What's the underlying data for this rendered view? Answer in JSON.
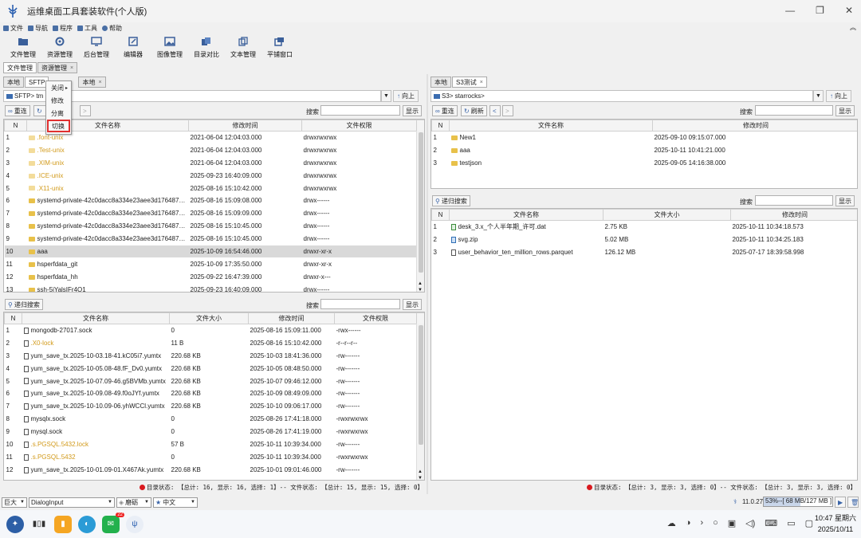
{
  "app": {
    "title": "运维桌面工具套装软件(个人版)"
  },
  "menu": [
    {
      "label": "文件",
      "icon": "file-icon"
    },
    {
      "label": "导航",
      "icon": "navigation-icon"
    },
    {
      "label": "程序",
      "icon": "program-icon"
    },
    {
      "label": "工具",
      "icon": "tools-icon"
    },
    {
      "label": "帮助",
      "icon": "help-icon"
    }
  ],
  "toolbar": [
    {
      "label": "文件管理",
      "icon": "folder-open-icon"
    },
    {
      "label": "资源管理",
      "icon": "resource-icon"
    },
    {
      "label": "后台管理",
      "icon": "monitor-icon"
    },
    {
      "label": "编辑器",
      "icon": "edit-icon"
    },
    {
      "label": "图像管理",
      "icon": "image-icon"
    },
    {
      "label": "目录对比",
      "icon": "compare-icon"
    },
    {
      "label": "文本管理",
      "icon": "text-icon"
    },
    {
      "label": "平铺窗口",
      "icon": "tile-windows-icon"
    }
  ],
  "main_tabs": [
    {
      "label": "文件管理"
    },
    {
      "label": "资源管理"
    }
  ],
  "left": {
    "tabs": [
      {
        "label": "本地"
      },
      {
        "label": "SFTP"
      },
      {
        "label": "本地"
      }
    ],
    "path": "SFTP> tm",
    "up_label": "向上",
    "refresh_label": "重连",
    "search_label": "搜索",
    "show_label": "显示",
    "headers": [
      "N",
      "文件名称",
      "修改时间",
      "文件权限"
    ],
    "rows": [
      {
        "n": "1",
        "name": ".font-unix",
        "time": "2021-06-04 12:04:03.000",
        "perm": "drwxrwxrwx",
        "hidden": true
      },
      {
        "n": "2",
        "name": ".Test-unix",
        "time": "2021-06-04 12:04:03.000",
        "perm": "drwxrwxrwx",
        "hidden": true
      },
      {
        "n": "3",
        "name": ".XIM-unix",
        "time": "2021-06-04 12:04:03.000",
        "perm": "drwxrwxrwx",
        "hidden": true
      },
      {
        "n": "4",
        "name": ".ICE-unix",
        "time": "2025-09-23 16:40:09.000",
        "perm": "drwxrwxrwx",
        "hidden": true
      },
      {
        "n": "5",
        "name": ".X11-unix",
        "time": "2025-08-16 15:10:42.000",
        "perm": "drwxrwxrwx",
        "hidden": true
      },
      {
        "n": "6",
        "name": "systemd-private-42c0dacc8a334e23aee3d1764873...",
        "time": "2025-08-16 15:09:08.000",
        "perm": "drwx------",
        "hidden": false
      },
      {
        "n": "7",
        "name": "systemd-private-42c0dacc8a334e23aee3d1764873...",
        "time": "2025-08-16 15:09:09.000",
        "perm": "drwx------",
        "hidden": false
      },
      {
        "n": "8",
        "name": "systemd-private-42c0dacc8a334e23aee3d1764873...",
        "time": "2025-08-16 15:10:45.000",
        "perm": "drwx------",
        "hidden": false
      },
      {
        "n": "9",
        "name": "systemd-private-42c0dacc8a334e23aee3d1764873...",
        "time": "2025-08-16 15:10:45.000",
        "perm": "drwx------",
        "hidden": false
      },
      {
        "n": "10",
        "name": "aaa",
        "time": "2025-10-09 16:54:46.000",
        "perm": "drwxr-xr-x",
        "hidden": false,
        "selected": true
      },
      {
        "n": "11",
        "name": "hsperfdata_git",
        "time": "2025-10-09 17:35:50.000",
        "perm": "drwxr-xr-x",
        "hidden": false
      },
      {
        "n": "12",
        "name": "hsperfdata_hh",
        "time": "2025-09-22 16:47:39.000",
        "perm": "drwxr-x---",
        "hidden": false
      },
      {
        "n": "13",
        "name": "ssh-5jYalsIFr4Q1",
        "time": "2025-09-23 16:40:09.000",
        "perm": "drwx------",
        "hidden": false
      }
    ],
    "context_menu": [
      "关闭",
      "修改",
      "分离",
      "切换"
    ],
    "recursive_search_label": "递归搜索",
    "file_headers": [
      "N",
      "文件名称",
      "文件大小",
      "修改时间",
      "文件权限"
    ],
    "files": [
      {
        "n": "1",
        "name": "mongodb-27017.sock",
        "size": "0",
        "time": "2025-08-16 15:09:11.000",
        "perm": "-rwx------",
        "hidden": false
      },
      {
        "n": "2",
        "name": ".X0-lock",
        "size": "11 B",
        "time": "2025-08-16 15:10:42.000",
        "perm": "-r--r--r--",
        "hidden": true
      },
      {
        "n": "3",
        "name": "yum_save_tx.2025-10-03.18-41.kC05i7.yumtx",
        "size": "220.68 KB",
        "time": "2025-10-03 18:41:36.000",
        "perm": "-rw-------",
        "hidden": false
      },
      {
        "n": "4",
        "name": "yum_save_tx.2025-10-05.08-48.fF_Dv0.yumtx",
        "size": "220.68 KB",
        "time": "2025-10-05 08:48:50.000",
        "perm": "-rw-------",
        "hidden": false
      },
      {
        "n": "5",
        "name": "yum_save_tx.2025-10-07.09-46.g5BVMb.yumtx",
        "size": "220.68 KB",
        "time": "2025-10-07 09:46:12.000",
        "perm": "-rw-------",
        "hidden": false
      },
      {
        "n": "6",
        "name": "yum_save_tx.2025-10-09.08-49.f0oJYf.yumtx",
        "size": "220.68 KB",
        "time": "2025-10-09 08:49:09.000",
        "perm": "-rw-------",
        "hidden": false
      },
      {
        "n": "7",
        "name": "yum_save_tx.2025-10-10.09-06.yhWCCl.yumtx",
        "size": "220.68 KB",
        "time": "2025-10-10 09:06:17.000",
        "perm": "-rw-------",
        "hidden": false
      },
      {
        "n": "8",
        "name": "mysqlx.sock",
        "size": "0",
        "time": "2025-08-26 17:41:18.000",
        "perm": "-rwxrwxrwx",
        "hidden": false
      },
      {
        "n": "9",
        "name": "mysql.sock",
        "size": "0",
        "time": "2025-08-26 17:41:19.000",
        "perm": "-rwxrwxrwx",
        "hidden": false
      },
      {
        "n": "10",
        "name": ".s.PGSQL.5432.lock",
        "size": "57 B",
        "time": "2025-10-11 10:39:34.000",
        "perm": "-rw-------",
        "hidden": true
      },
      {
        "n": "11",
        "name": ".s.PGSQL.5432",
        "size": "0",
        "time": "2025-10-11 10:39:34.000",
        "perm": "-rwxrwxrwx",
        "hidden": true
      },
      {
        "n": "12",
        "name": "yum_save_tx.2025-10-01.09-01.X467Ak.yumtx",
        "size": "220.68 KB",
        "time": "2025-10-01 09:01:46.000",
        "perm": "-rw-------",
        "hidden": false
      }
    ],
    "status": "目录状态: 【总计: 16, 显示: 16, 选择: 1】-- 文件状态: 【总计: 15, 显示: 15, 选择: 0】"
  },
  "right": {
    "tabs": [
      {
        "label": "本地"
      },
      {
        "label": "S3测试"
      }
    ],
    "path": "S3> starrocks>",
    "up_label": "向上",
    "refresh_label": "重连",
    "refresh2_label": "刷新",
    "search_label": "搜索",
    "show_label": "显示",
    "headers": [
      "N",
      "文件名称",
      "修改时间"
    ],
    "rows": [
      {
        "n": "1",
        "name": "New1",
        "time": "2025-09-10 09:15:07.000"
      },
      {
        "n": "2",
        "name": "aaa",
        "time": "2025-10-11 10:41:21.000"
      },
      {
        "n": "3",
        "name": "testjson",
        "time": "2025-09-05 14:16:38.000"
      }
    ],
    "recursive_search_label": "递归搜索",
    "file_headers": [
      "N",
      "文件名称",
      "文件大小",
      "修改时间"
    ],
    "files": [
      {
        "n": "1",
        "name": "desk_3.x_个人半年期_许可.dat",
        "size": "2.75 KB",
        "time": "2025-10-11 10:34:18.573",
        "kind": "dat"
      },
      {
        "n": "2",
        "name": "svg.zip",
        "size": "5.02 MB",
        "time": "2025-10-11 10:34:25.183",
        "kind": "zip"
      },
      {
        "n": "3",
        "name": "user_behavior_ten_million_rows.parquet",
        "size": "126.12 MB",
        "time": "2025-07-17 18:39:58.998",
        "kind": "doc"
      }
    ],
    "status": "目录状态: 【总计: 3, 显示: 3, 选择: 0】-- 文件状态: 【总计: 3, 显示: 3, 选择: 0】"
  },
  "bottom": {
    "size_select": "巨大",
    "font_select": "DialogInput",
    "theme_select": "磨砺",
    "lang_select": "中文",
    "version": "11.0.27",
    "memory": "53%--[ 68 MB/127 MB ]",
    "memory_fraction": 0.53
  },
  "taskbar": {
    "badge": "22",
    "time": "10:47 星期六",
    "date": "2025/10/11"
  }
}
